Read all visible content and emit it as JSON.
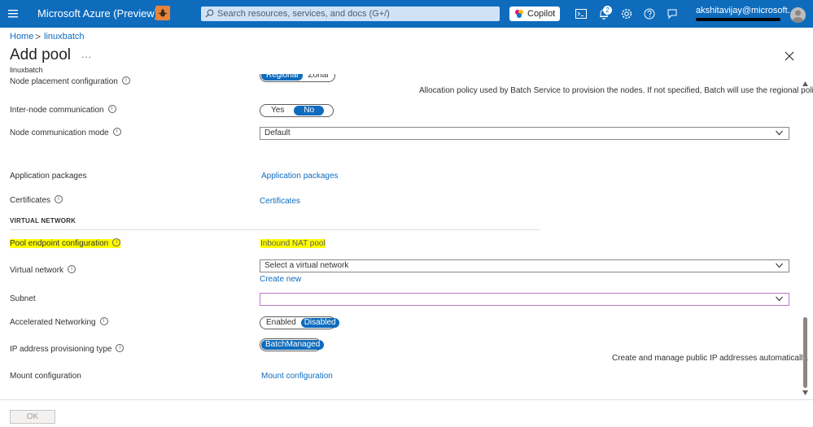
{
  "topbar": {
    "brand": "Microsoft Azure (Preview)",
    "search_placeholder": "Search resources, services, and docs (G+/)",
    "copilot_label": "Copilot",
    "notification_count": "2",
    "user": "akshitavijay@microsoft...",
    "accent_color": "#0f6cbd",
    "icons": [
      "menu-icon",
      "bug-icon",
      "search-icon",
      "copilot-icon",
      "cloud-shell-icon",
      "bell-icon",
      "gear-icon",
      "help-icon",
      "feedback-icon",
      "avatar"
    ]
  },
  "breadcrumb": {
    "home": "Home",
    "sep": ">",
    "parent": "linuxbatch"
  },
  "header": {
    "title": "Add pool",
    "more": "...",
    "subtitle": "linuxbatch"
  },
  "form": {
    "node_placement": {
      "label": "Node placement configuration",
      "options": [
        "Regional",
        "Zonal"
      ],
      "selected": "Regional",
      "description": "Allocation policy used by Batch Service to provision the nodes. If not specified, Batch will use the regional policy."
    },
    "inter_node": {
      "label": "Inter-node communication",
      "options": [
        "Yes",
        "No"
      ],
      "selected": "No"
    },
    "node_comm_mode": {
      "label": "Node communication mode",
      "value": "Default"
    },
    "app_packages": {
      "label": "Application packages",
      "link": "Application packages"
    },
    "certificates": {
      "label": "Certificates",
      "link": "Certificates"
    },
    "section_virtual_network": "VIRTUAL NETWORK",
    "pool_endpoint": {
      "label": "Pool endpoint configuration",
      "link": "Inbound NAT pool"
    },
    "virtual_network": {
      "label": "Virtual network",
      "placeholder": "Select a virtual network",
      "create_new": "Create new"
    },
    "subnet": {
      "label": "Subnet",
      "value": ""
    },
    "accelerated_networking": {
      "label": "Accelerated Networking",
      "options": [
        "Enabled",
        "Disabled"
      ],
      "selected": "Disabled"
    },
    "ip_provisioning": {
      "label": "IP address provisioning type",
      "options": [
        "BatchManaged"
      ],
      "selected": "BatchManaged",
      "description": "Create and manage public IP addresses automatically."
    },
    "mount": {
      "label": "Mount configuration",
      "link": "Mount configuration"
    }
  },
  "footer": {
    "ok_label": "OK"
  }
}
